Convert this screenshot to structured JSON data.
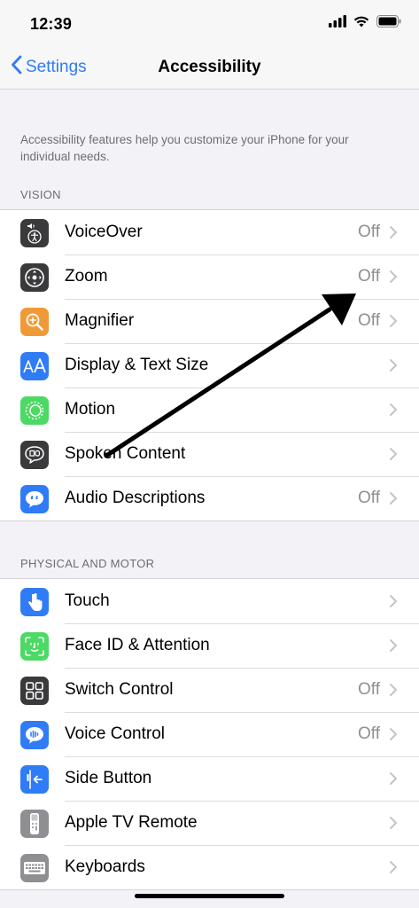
{
  "status_bar": {
    "time": "12:39"
  },
  "nav": {
    "back_label": "Settings",
    "title": "Accessibility"
  },
  "description": "Accessibility features help you customize your iPhone for your individual needs.",
  "sections": [
    {
      "header": "VISION",
      "items": [
        {
          "label": "VoiceOver",
          "value": "Off",
          "icon": "voiceover-icon",
          "color": "#3a3a3c"
        },
        {
          "label": "Zoom",
          "value": "Off",
          "icon": "zoom-icon",
          "color": "#3a3a3c"
        },
        {
          "label": "Magnifier",
          "value": "Off",
          "icon": "magnifier-icon",
          "color": "#f09a37"
        },
        {
          "label": "Display & Text Size",
          "value": "",
          "icon": "display-text-size-icon",
          "color": "#2f7cf6"
        },
        {
          "label": "Motion",
          "value": "",
          "icon": "motion-icon",
          "color": "#4cd964"
        },
        {
          "label": "Spoken Content",
          "value": "",
          "icon": "spoken-content-icon",
          "color": "#3a3a3c"
        },
        {
          "label": "Audio Descriptions",
          "value": "Off",
          "icon": "audio-descriptions-icon",
          "color": "#2f7cf6"
        }
      ]
    },
    {
      "header": "PHYSICAL AND MOTOR",
      "items": [
        {
          "label": "Touch",
          "value": "",
          "icon": "touch-icon",
          "color": "#2f7cf6"
        },
        {
          "label": "Face ID & Attention",
          "value": "",
          "icon": "face-id-icon",
          "color": "#4cd964"
        },
        {
          "label": "Switch Control",
          "value": "Off",
          "icon": "switch-control-icon",
          "color": "#3a3a3c"
        },
        {
          "label": "Voice Control",
          "value": "Off",
          "icon": "voice-control-icon",
          "color": "#2f7cf6"
        },
        {
          "label": "Side Button",
          "value": "",
          "icon": "side-button-icon",
          "color": "#2f7cf6"
        },
        {
          "label": "Apple TV Remote",
          "value": "",
          "icon": "apple-tv-remote-icon",
          "color": "#8e8e93"
        },
        {
          "label": "Keyboards",
          "value": "",
          "icon": "keyboard-icon",
          "color": "#8e8e93"
        }
      ]
    }
  ],
  "colors": {
    "accent": "#2f7cf6",
    "secondary_text": "#8e8e93",
    "background": "#f2f2f7"
  }
}
